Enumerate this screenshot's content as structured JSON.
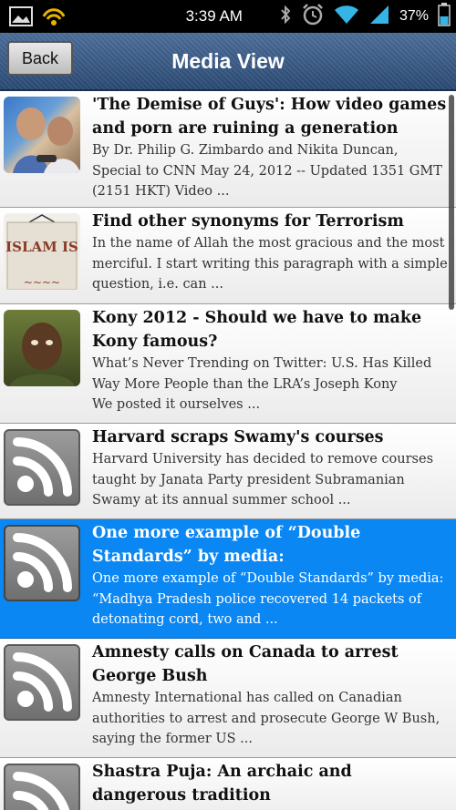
{
  "status_bar": {
    "time": "3:39 AM",
    "battery_percent": "37%",
    "icons": [
      "gallery-icon",
      "wifi-broadcast-icon",
      "bluetooth-icon",
      "alarm-icon",
      "wifi-icon",
      "signal-icon",
      "battery-icon"
    ]
  },
  "header": {
    "back_label": "Back",
    "title": "Media View",
    "color": "#3c5d87"
  },
  "articles": [
    {
      "title": "'The Demise of Guys': How video games and porn are ruining a generation",
      "snippet": "By Dr. Philip G. Zimbardo and Nikita Duncan, Special to CNN May 24, 2012 -- Updated 1351 GMT (2151 HKT) Video ...",
      "thumbnail": "kids-gaming-photo"
    },
    {
      "title": "Find other synonyms for Terrorism",
      "snippet": "In the name of Allah the most gracious and the most merciful. I start writing this paragraph with a simple question, i.e. can ...",
      "thumbnail": "islam-sign-photo",
      "thumbnail_text": "ISLAM IS"
    },
    {
      "title": "Kony 2012 - Should we have to make Kony famous?",
      "snippet": "What’s Never Trending on Twitter: U.S. Has Killed Way More People than the LRA’s Joseph Kony\nWe posted it ourselves ...",
      "thumbnail": "portrait-photo"
    },
    {
      "title": "Harvard scraps Swamy's courses",
      "snippet": "Harvard University has decided to remove courses taught by Janata Party president Subramanian Swamy at its annual summer school ...",
      "thumbnail": "rss-icon"
    },
    {
      "title": "One more example of “Double Standards” by media:",
      "snippet": "One more example of “Double Standards” by media: “Madhya Pradesh police recovered 14 packets of detonating cord, two and ...",
      "thumbnail": "rss-icon",
      "selected": true
    },
    {
      "title": "Amnesty calls on Canada to arrest George Bush",
      "snippet": "Amnesty International has called on Canadian authorities to arrest and prosecute George W Bush, saying the former US ...",
      "thumbnail": "rss-icon"
    },
    {
      "title": "Shastra Puja: An archaic and dangerous tradition",
      "snippet": "",
      "thumbnail": "rss-icon"
    }
  ],
  "colors": {
    "selected_row": "#0b87f4",
    "header_bar": "#3c5d87",
    "status_bar": "#000000"
  }
}
